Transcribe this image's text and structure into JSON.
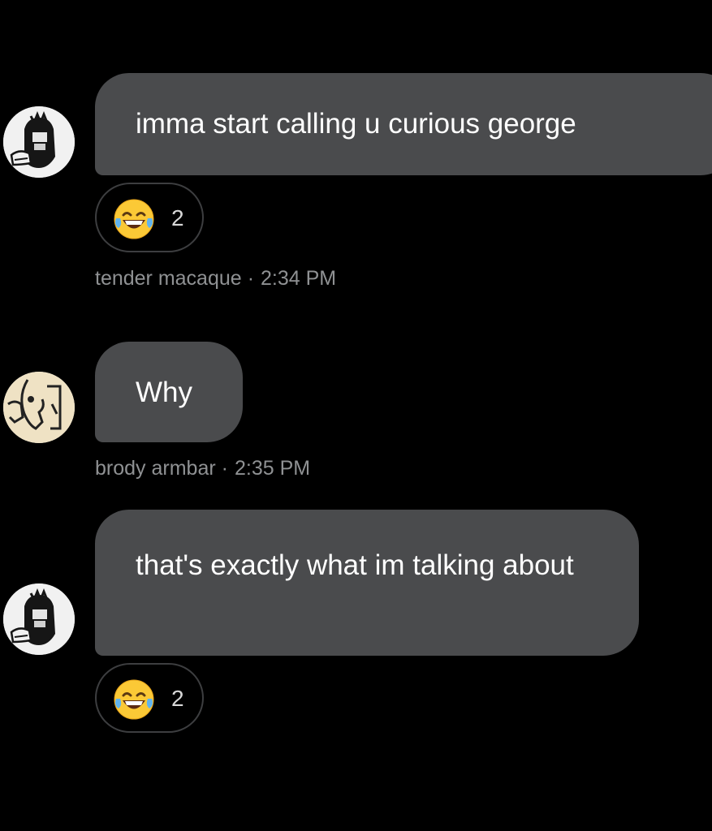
{
  "messages": [
    {
      "text": "imma start calling u curious george",
      "reaction": {
        "emoji": "face-with-tears-of-joy",
        "count": "2"
      },
      "sender": "tender macaque",
      "separator": "·",
      "time": "2:34 PM"
    },
    {
      "text": "Why",
      "sender": "brody armbar",
      "separator": "·",
      "time": "2:35 PM"
    },
    {
      "text": "that's exactly what im talking about",
      "reaction": {
        "emoji": "face-with-tears-of-joy",
        "count": "2"
      }
    }
  ],
  "colors": {
    "background": "#000000",
    "bubble": "#4a4b4d",
    "meta_text": "#8f9193",
    "reaction_border": "#3d3e40"
  }
}
